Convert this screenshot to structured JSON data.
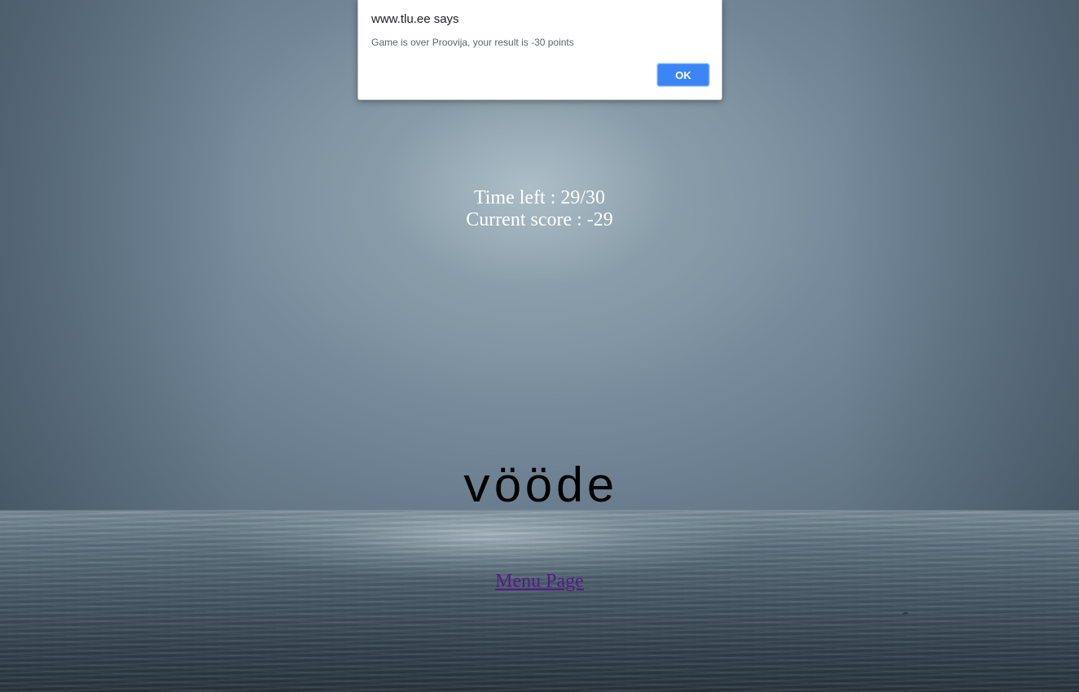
{
  "dialog": {
    "title": "www.tlu.ee says",
    "message": "Game is over Proovija, your result is -30 points",
    "ok_label": "OK"
  },
  "game": {
    "time_left": "Time left : 29/30",
    "current_score": "Current score : -29",
    "word": "vööde",
    "menu_link": "Menu Page"
  },
  "colors": {
    "ok_button": "#3b86f7",
    "link_visited": "#551a8b",
    "stats_text": "#ffffff",
    "word_text": "#000000"
  }
}
